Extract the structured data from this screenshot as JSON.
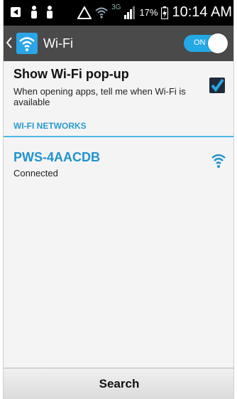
{
  "status_bar": {
    "network_type": "3G",
    "battery_percent": "17%",
    "time": "10:14 AM",
    "icons": [
      "notification-icon",
      "person-icon",
      "person-icon",
      "warning-icon",
      "wifi-icon",
      "signal-icon",
      "battery-icon"
    ]
  },
  "action_bar": {
    "title": "Wi-Fi",
    "toggle_label": "ON",
    "toggle_on": true,
    "accent_color": "#2aa5e8"
  },
  "popup_setting": {
    "title": "Show Wi-Fi pop-up",
    "description": "When opening apps, tell me when Wi-Fi is available",
    "checked": true
  },
  "networks_section": {
    "header": "WI-FI NETWORKS",
    "networks": [
      {
        "name": "PWS-4AACDB",
        "status": "Connected"
      }
    ]
  },
  "footer": {
    "search_label": "Search"
  }
}
